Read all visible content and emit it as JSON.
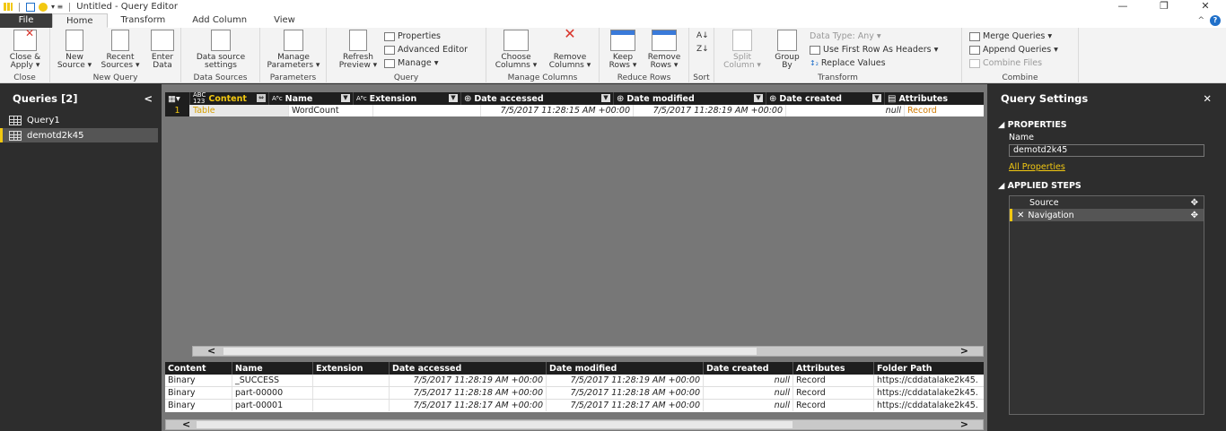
{
  "title": "Untitled - Query Editor",
  "window_buttons": [
    "—",
    "❐",
    "✕"
  ],
  "tabs": [
    "File",
    "Home",
    "Transform",
    "Add Column",
    "View"
  ],
  "ribbon": {
    "close_apply": "Close &",
    "close_apply2": "Apply ▾",
    "new_source": "New",
    "new_source2": "Source ▾",
    "recent_sources": "Recent",
    "recent_sources2": "Sources ▾",
    "enter_data": "Enter",
    "enter_data2": "Data",
    "data_source_settings": "Data source",
    "data_source_settings2": "settings",
    "manage_parameters": "Manage",
    "manage_parameters2": "Parameters ▾",
    "refresh_preview": "Refresh",
    "refresh_preview2": "Preview ▾",
    "properties": "Properties",
    "advanced_editor": "Advanced Editor",
    "manage": "Manage ▾",
    "choose_columns": "Choose",
    "choose_columns2": "Columns ▾",
    "remove_columns": "Remove",
    "remove_columns2": "Columns ▾",
    "keep_rows": "Keep",
    "keep_rows2": "Rows ▾",
    "remove_rows": "Remove",
    "remove_rows2": "Rows ▾",
    "split_column": "Split",
    "split_column2": "Column ▾",
    "group_by": "Group",
    "group_by2": "By",
    "data_type": "Data Type: Any ▾",
    "use_first_row": "Use First Row As Headers ▾",
    "replace_values": "Replace Values",
    "merge_queries": "Merge Queries ▾",
    "append_queries": "Append Queries ▾",
    "combine_files": "Combine Files",
    "groups": {
      "close": "Close",
      "new_query": "New Query",
      "data_sources": "Data Sources",
      "parameters": "Parameters",
      "query": "Query",
      "manage_columns": "Manage Columns",
      "reduce_rows": "Reduce Rows",
      "sort": "Sort",
      "transform": "Transform",
      "combine": "Combine"
    }
  },
  "queries": {
    "header": "Queries [2]",
    "collapse": "<",
    "items": [
      "Query1",
      "demotd2k45"
    ]
  },
  "main_grid": {
    "columns": [
      {
        "type": "ABC\n123",
        "label": "Content"
      },
      {
        "type": "ABC",
        "label": "Name"
      },
      {
        "type": "ABC",
        "label": "Extension"
      },
      {
        "type": "⊕",
        "label": "Date accessed"
      },
      {
        "type": "⊕",
        "label": "Date modified"
      },
      {
        "type": "⊕",
        "label": "Date created"
      },
      {
        "type": "▤",
        "label": "Attributes"
      }
    ],
    "row": {
      "num": "1",
      "content": "Table",
      "name": "WordCount",
      "extension": "",
      "date_accessed": "7/5/2017 11:28:15 AM +00:00",
      "date_modified": "7/5/2017 11:28:19 AM +00:00",
      "date_created": "null",
      "attributes": "Record"
    }
  },
  "preview": {
    "columns": [
      "Content",
      "Name",
      "Extension",
      "Date accessed",
      "Date modified",
      "Date created",
      "Attributes",
      "Folder Path"
    ],
    "rows": [
      [
        "Binary",
        "_SUCCESS",
        "",
        "7/5/2017 11:28:19 AM +00:00",
        "7/5/2017 11:28:19 AM +00:00",
        "null",
        "Record",
        "https://cddatalake2k45."
      ],
      [
        "Binary",
        "part-00000",
        "",
        "7/5/2017 11:28:18 AM +00:00",
        "7/5/2017 11:28:18 AM +00:00",
        "null",
        "Record",
        "https://cddatalake2k45."
      ],
      [
        "Binary",
        "part-00001",
        "",
        "7/5/2017 11:28:17 AM +00:00",
        "7/5/2017 11:28:17 AM +00:00",
        "null",
        "Record",
        "https://cddatalake2k45."
      ]
    ]
  },
  "settings": {
    "header": "Query Settings",
    "close": "✕",
    "properties_title": "◢ PROPERTIES",
    "name_label": "Name",
    "name_value": "demotd2k45",
    "all_properties": "All Properties",
    "applied_steps_title": "◢ APPLIED STEPS",
    "steps": [
      "Source",
      "Navigation"
    ]
  },
  "colors": {
    "accent": "#f2c811",
    "dark": "#2d2d2d",
    "grid": "#777777"
  }
}
